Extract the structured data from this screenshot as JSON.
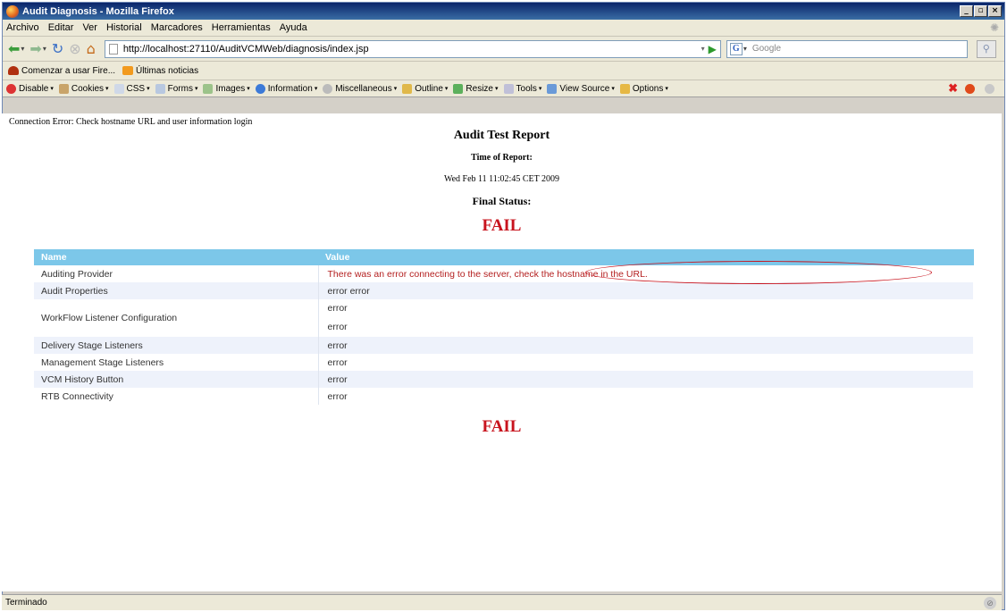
{
  "window": {
    "title": "Audit Diagnosis - Mozilla Firefox",
    "btn_min": "_",
    "btn_max": "▫",
    "btn_close": "×"
  },
  "menu": [
    "Archivo",
    "Editar",
    "Ver",
    "Historial",
    "Marcadores",
    "Herramientas",
    "Ayuda"
  ],
  "nav": {
    "url": "http://localhost:27110/AuditVCMWeb/diagnosis/index.jsp",
    "search_placeholder": "Google"
  },
  "bookmarks": [
    "Comenzar a usar Fire...",
    "Últimas noticias"
  ],
  "devbar": [
    "Disable",
    "Cookies",
    "CSS",
    "Forms",
    "Images",
    "Information",
    "Miscellaneous",
    "Outline",
    "Resize",
    "Tools",
    "View Source",
    "Options"
  ],
  "page": {
    "connection_error": "Connection Error: Check hostname URL and user information login",
    "title": "Audit Test Report",
    "time_label": "Time of Report:",
    "time_value": "Wed Feb 11 11:02:45 CET 2009",
    "final_label": "Final Status:",
    "status": "FAIL",
    "status_bottom": "FAIL",
    "table": {
      "headers": [
        "Name",
        "Value"
      ],
      "rows": [
        {
          "name": "Auditing Provider",
          "value": "There was an error connecting to the server, check the hostname in the URL."
        },
        {
          "name": "Audit Properties",
          "value": "error error"
        },
        {
          "name": "WorkFlow Listener Configuration",
          "value": "error",
          "value2": "error"
        },
        {
          "name": "Delivery Stage Listeners",
          "value": "error"
        },
        {
          "name": "Management Stage Listeners",
          "value": "error"
        },
        {
          "name": "VCM History Button",
          "value": "error"
        },
        {
          "name": "RTB Connectivity",
          "value": "error"
        }
      ]
    }
  },
  "status": {
    "text": "Terminado"
  },
  "colors": {
    "fail": "#c8141e",
    "table_header": "#7cc7e9",
    "row_alt": "#eef2fb"
  }
}
